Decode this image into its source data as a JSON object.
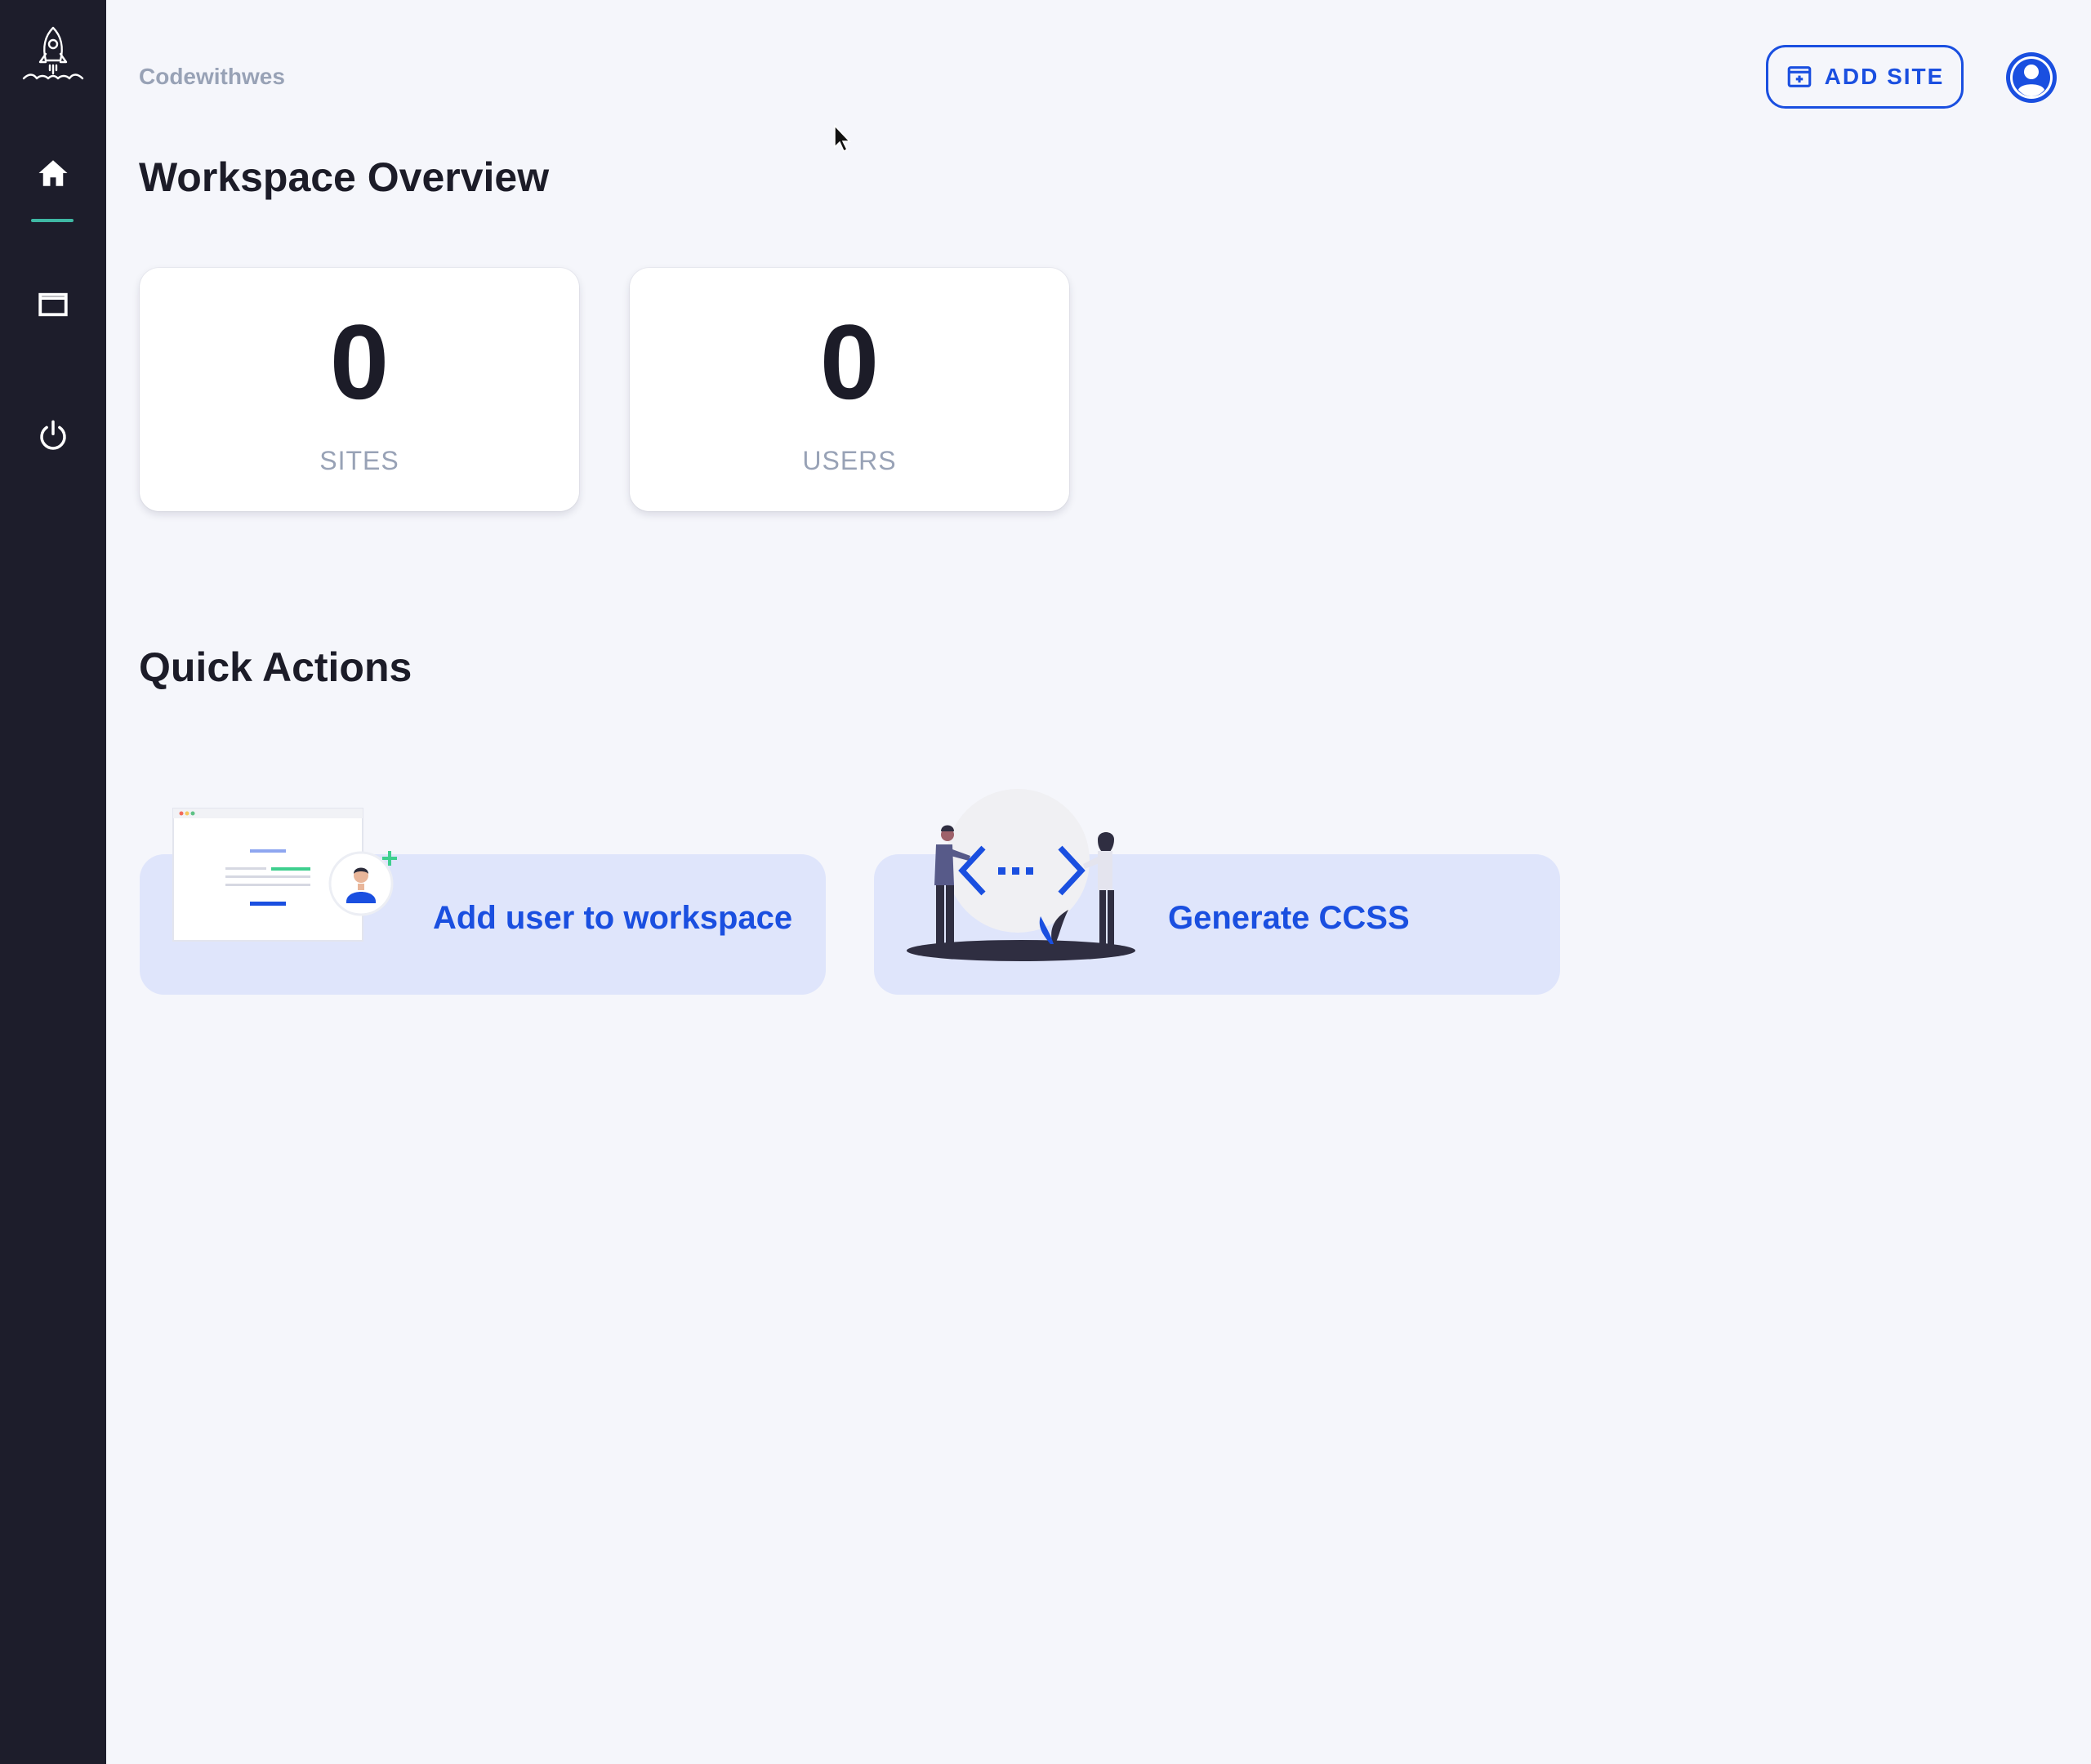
{
  "sidebar": {
    "items": [
      {
        "name": "home",
        "icon": "home-icon",
        "active": true
      },
      {
        "name": "sites",
        "icon": "window-icon",
        "active": false
      },
      {
        "name": "logout",
        "icon": "power-icon",
        "active": false
      }
    ],
    "logo_icon": "rocket-logo-icon"
  },
  "header": {
    "workspace_name": "Codewithwes",
    "add_site_label": "ADD SITE",
    "add_site_icon": "add-window-icon",
    "avatar_icon": "user-avatar-icon"
  },
  "overview": {
    "title": "Workspace Overview",
    "stats": [
      {
        "value": "0",
        "caption": "SITES"
      },
      {
        "value": "0",
        "caption": "USERS"
      }
    ]
  },
  "quick_actions": {
    "title": "Quick Actions",
    "items": [
      {
        "label": "Add user to workspace",
        "illustration": "add-user-illustration"
      },
      {
        "label": "Generate CCSS",
        "illustration": "code-collaboration-illustration"
      }
    ]
  },
  "colors": {
    "sidebar_bg": "#1d1d2b",
    "page_bg": "#f5f6fb",
    "accent_blue": "#1a4fe0",
    "active_indicator": "#3fb8a4",
    "quick_action_bg": "#dfe5fb",
    "muted_text": "#98a2b6"
  }
}
